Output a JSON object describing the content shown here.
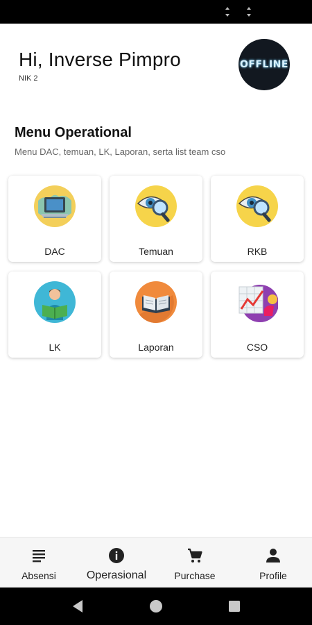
{
  "header": {
    "greeting": "Hi, Inverse Pimpro",
    "nik": "NIK 2",
    "avatar_text": "OFFLINE"
  },
  "section": {
    "title": "Menu Operational",
    "subtitle": "Menu DAC, temuan, LK, Laporan, serta list team cso"
  },
  "menu": [
    {
      "label": "DAC",
      "icon": "computer-icon"
    },
    {
      "label": "Temuan",
      "icon": "eye-magnifier-icon"
    },
    {
      "label": "RKB",
      "icon": "eye-magnifier-icon"
    },
    {
      "label": "LK",
      "icon": "reader-icon"
    },
    {
      "label": "Laporan",
      "icon": "book-icon"
    },
    {
      "label": "CSO",
      "icon": "chart-presentation-icon"
    }
  ],
  "bottom_nav": [
    {
      "label": "Absensi",
      "icon": "list-icon",
      "active": false
    },
    {
      "label": "Operasional",
      "icon": "info-icon",
      "active": true
    },
    {
      "label": "Purchase",
      "icon": "cart-icon",
      "active": false
    },
    {
      "label": "Profile",
      "icon": "person-icon",
      "active": false
    }
  ]
}
